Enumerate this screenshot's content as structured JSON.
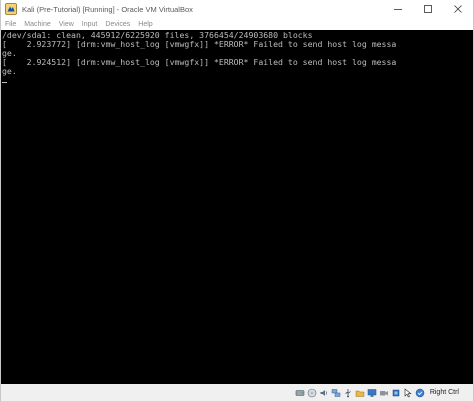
{
  "window": {
    "title": "Kali (Pre-Tutorial) [Running] - Oracle VM VirtualBox"
  },
  "menu": {
    "items": [
      "File",
      "Machine",
      "View",
      "Input",
      "Devices",
      "Help"
    ]
  },
  "console": {
    "lines": [
      "/dev/sda1: clean, 445912/6225920 files, 3766454/24903680 blocks",
      "[    2.923772] [drm:vmw_host_log [vmwgfx]] *ERROR* Failed to send host log messa",
      "ge.",
      "[    2.924512] [drm:vmw_host_log [vmwgfx]] *ERROR* Failed to send host log messa",
      "ge."
    ]
  },
  "statusbar": {
    "host_key_label": "Right Ctrl",
    "icons": [
      "hard-disk-icon",
      "optical-disk-icon",
      "audio-icon",
      "network-icon",
      "usb-icon",
      "shared-folder-icon",
      "display-icon",
      "video-capture-icon",
      "cpu-activity-icon",
      "mouse-integration-icon",
      "keyboard-capture-icon"
    ]
  },
  "colors": {
    "console_background": "#000000",
    "console_text": "#bdbdbd",
    "statusbar_background": "#f0f0f0",
    "vbox_blue": "#2f6fbf"
  }
}
